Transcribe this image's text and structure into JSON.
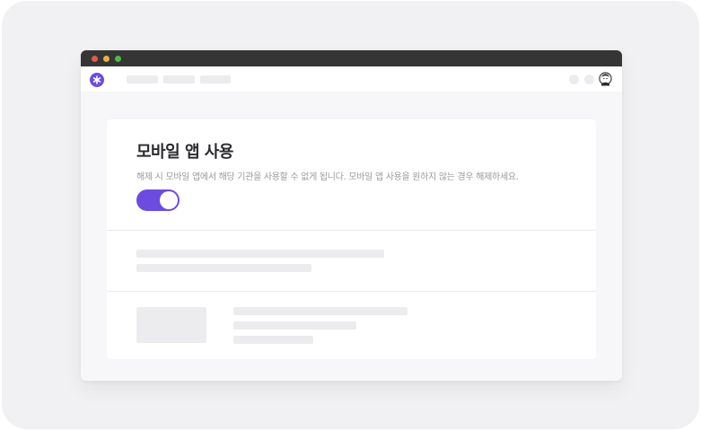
{
  "window": {
    "traffic_lights": {
      "close_color": "#e5584f",
      "minimize_color": "#e7b13f",
      "maximize_color": "#4fb845"
    }
  },
  "navbar": {
    "logo_icon": "asterisk-icon",
    "brand_color": "#6c4ce0",
    "avatar_icon": "user-avatar-icon"
  },
  "settings": {
    "title": "모바일 앱 사용",
    "description": "해제 시 모바일 앱에서 해당 기관을 사용할 수 없게 됩니다. 모바일 앱 사용을 원하지 않는 경우 해제하세요.",
    "toggle": {
      "state": "on",
      "color": "#6c4ce0"
    }
  }
}
